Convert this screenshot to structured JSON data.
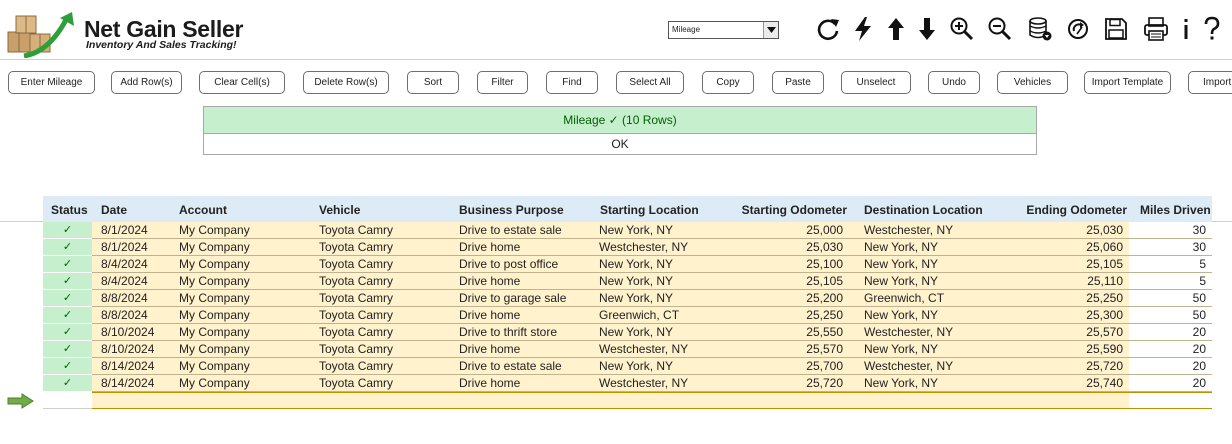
{
  "brand": {
    "title": "Net Gain Seller",
    "tagline": "Inventory And Sales Tracking!"
  },
  "sheet_select": {
    "value": "Mileage"
  },
  "toolbar_icons": [
    "refresh-icon",
    "lightning-icon",
    "arrow-up-icon",
    "arrow-down-icon",
    "zoom-in-icon",
    "zoom-out-icon",
    "database-icon",
    "sync-icon",
    "save-icon",
    "print-icon",
    "info-icon",
    "help-icon"
  ],
  "commands": [
    "Enter Mileage",
    "Add Row(s)",
    "Clear Cell(s)",
    "Delete Row(s)",
    "Sort",
    "Filter",
    "Find",
    "Select All",
    "Copy",
    "Paste",
    "Unselect",
    "Undo",
    "Vehicles",
    "Import Template",
    "Import M"
  ],
  "notice": {
    "message": "Mileage ✓ (10 Rows)",
    "ok": "OK"
  },
  "table": {
    "columns": [
      "Status",
      "Date",
      "Account",
      "Vehicle",
      "Business Purpose",
      "Starting Location",
      "Starting Odometer",
      "Destination Location",
      "Ending Odometer",
      "Miles Driven"
    ],
    "rows": [
      {
        "status": "✓",
        "date": "8/1/2024",
        "account": "My Company",
        "vehicle": "Toyota Camry",
        "purpose": "Drive to estate sale",
        "start": "New York, NY",
        "start_odo": "25,000",
        "dest": "Westchester, NY",
        "end_odo": "25,030",
        "miles": "30"
      },
      {
        "status": "✓",
        "date": "8/1/2024",
        "account": "My Company",
        "vehicle": "Toyota Camry",
        "purpose": "Drive home",
        "start": "Westchester, NY",
        "start_odo": "25,030",
        "dest": "New York, NY",
        "end_odo": "25,060",
        "miles": "30"
      },
      {
        "status": "✓",
        "date": "8/4/2024",
        "account": "My Company",
        "vehicle": "Toyota Camry",
        "purpose": "Drive to post office",
        "start": "New York, NY",
        "start_odo": "25,100",
        "dest": "New York, NY",
        "end_odo": "25,105",
        "miles": "5"
      },
      {
        "status": "✓",
        "date": "8/4/2024",
        "account": "My Company",
        "vehicle": "Toyota Camry",
        "purpose": "Drive home",
        "start": "New York, NY",
        "start_odo": "25,105",
        "dest": "New York, NY",
        "end_odo": "25,110",
        "miles": "5"
      },
      {
        "status": "✓",
        "date": "8/8/2024",
        "account": "My Company",
        "vehicle": "Toyota Camry",
        "purpose": "Drive to garage sale",
        "start": "New York, NY",
        "start_odo": "25,200",
        "dest": "Greenwich, CT",
        "end_odo": "25,250",
        "miles": "50"
      },
      {
        "status": "✓",
        "date": "8/8/2024",
        "account": "My Company",
        "vehicle": "Toyota Camry",
        "purpose": "Drive home",
        "start": "Greenwich, CT",
        "start_odo": "25,250",
        "dest": "New York, NY",
        "end_odo": "25,300",
        "miles": "50"
      },
      {
        "status": "✓",
        "date": "8/10/2024",
        "account": "My Company",
        "vehicle": "Toyota Camry",
        "purpose": "Drive to thrift store",
        "start": "New York, NY",
        "start_odo": "25,550",
        "dest": "Westchester, NY",
        "end_odo": "25,570",
        "miles": "20"
      },
      {
        "status": "✓",
        "date": "8/10/2024",
        "account": "My Company",
        "vehicle": "Toyota Camry",
        "purpose": "Drive home",
        "start": "Westchester, NY",
        "start_odo": "25,570",
        "dest": "New York, NY",
        "end_odo": "25,590",
        "miles": "20"
      },
      {
        "status": "✓",
        "date": "8/14/2024",
        "account": "My Company",
        "vehicle": "Toyota Camry",
        "purpose": "Drive to estate sale",
        "start": "New York, NY",
        "start_odo": "25,700",
        "dest": "Westchester, NY",
        "end_odo": "25,720",
        "miles": "20"
      },
      {
        "status": "✓",
        "date": "8/14/2024",
        "account": "My Company",
        "vehicle": "Toyota Camry",
        "purpose": "Drive home",
        "start": "Westchester, NY",
        "start_odo": "25,720",
        "dest": "New York, NY",
        "end_odo": "25,740",
        "miles": "20"
      }
    ]
  },
  "colors": {
    "status_green": "#c6efce",
    "status_text": "#006100",
    "row_band": "#fff2cc",
    "header_blue": "#ddebf7",
    "arrow_green": "#70ad47"
  }
}
